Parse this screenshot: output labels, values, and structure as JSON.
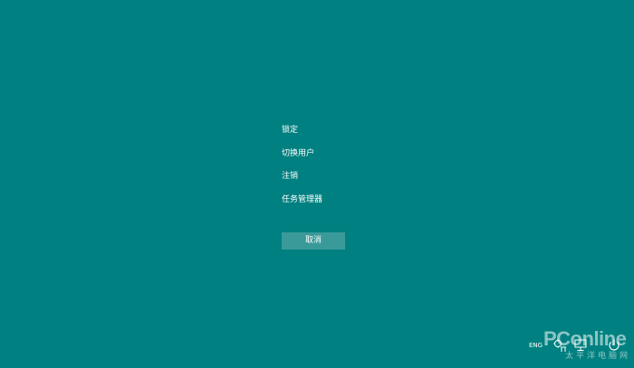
{
  "colors": {
    "background": "#008080",
    "text": "#ffffff",
    "cancel_button_bg": "#3a9a9a"
  },
  "menu": {
    "items": [
      {
        "label": "锁定"
      },
      {
        "label": "切换用户"
      },
      {
        "label": "注销"
      },
      {
        "label": "任务管理器"
      }
    ]
  },
  "cancel_button": {
    "label": "取消"
  },
  "tray": {
    "language": "ENG",
    "icons": [
      "ease-of-access-icon",
      "network-icon",
      "power-icon"
    ]
  },
  "watermark": {
    "logo": "PConline",
    "subtitle": "太平洋电脑网"
  }
}
